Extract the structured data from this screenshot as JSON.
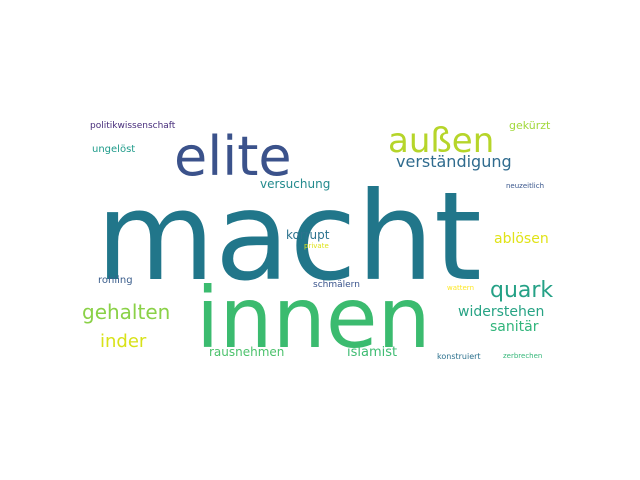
{
  "wordcloud": {
    "words": [
      {
        "text": "macht",
        "color": "#21768a"
      },
      {
        "text": "innen",
        "color": "#3bbb6f"
      },
      {
        "text": "elite",
        "color": "#3b528b"
      },
      {
        "text": "außen",
        "color": "#b6d52a"
      },
      {
        "text": "verständigung",
        "color": "#2f6b8e"
      },
      {
        "text": "quark",
        "color": "#25a186"
      },
      {
        "text": "gehalten",
        "color": "#8ad147"
      },
      {
        "text": "widerstehen",
        "color": "#27a384"
      },
      {
        "text": "sanitär",
        "color": "#31b57b"
      },
      {
        "text": "inder",
        "color": "#d8e219"
      },
      {
        "text": "ablösen",
        "color": "#e0e318"
      },
      {
        "text": "korrupt",
        "color": "#2c738e"
      },
      {
        "text": "versuchung",
        "color": "#238a8d"
      },
      {
        "text": "rausnehmen",
        "color": "#4cc26c"
      },
      {
        "text": "islamist",
        "color": "#3fbc73"
      },
      {
        "text": "gekürzt",
        "color": "#a2d93c"
      },
      {
        "text": "ungelöst",
        "color": "#1e9b8a"
      },
      {
        "text": "politikwissenschaft",
        "color": "#472d7b"
      },
      {
        "text": "rohling",
        "color": "#3b5e8c"
      },
      {
        "text": "schmälern",
        "color": "#3a548c"
      },
      {
        "text": "private",
        "color": "#dde318"
      },
      {
        "text": "konstruiert",
        "color": "#2c718e"
      },
      {
        "text": "zerbrechen",
        "color": "#35b779"
      },
      {
        "text": "neuzeitlich",
        "color": "#39568c"
      },
      {
        "text": "wattern",
        "color": "#fde725"
      }
    ]
  }
}
